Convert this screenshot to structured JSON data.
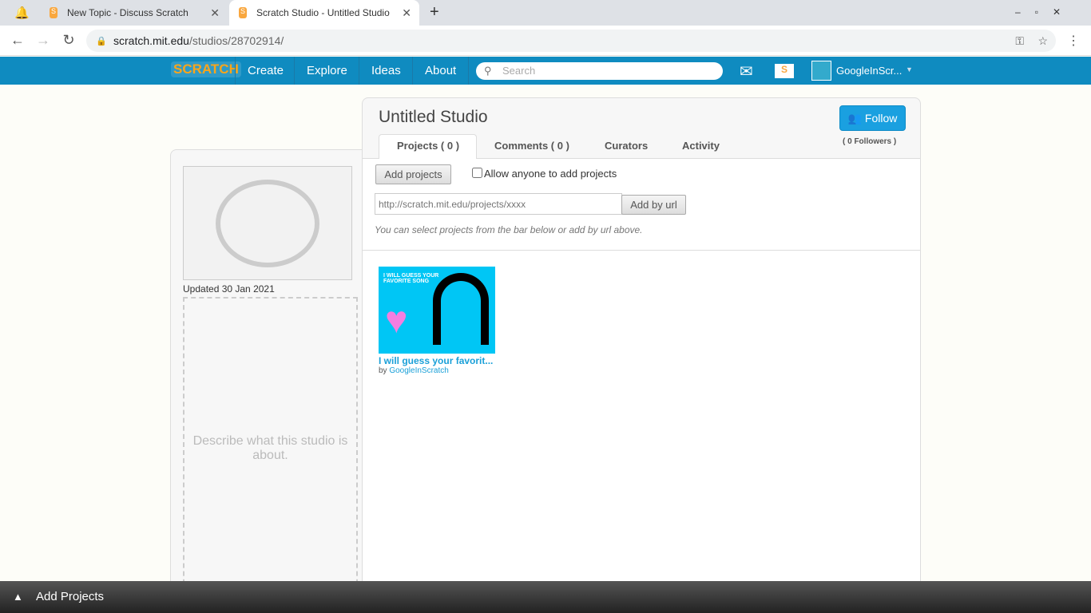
{
  "browser": {
    "tabs": [
      {
        "title": "New Topic - Discuss Scratch"
      },
      {
        "title": "Scratch Studio - Untitled Studio"
      }
    ],
    "url_host": "scratch.mit.edu",
    "url_path": "/studios/28702914/"
  },
  "nav": {
    "logo": "SCRATCH",
    "items": [
      "Create",
      "Explore",
      "Ideas",
      "About"
    ],
    "search_placeholder": "Search",
    "username": "GoogleInScr..."
  },
  "studio": {
    "title": "Untitled Studio",
    "follow": "Follow",
    "followers": "( 0 Followers )",
    "updated": "Updated 30 Jan 2021",
    "description_placeholder": "Describe what this studio is about.",
    "tabs": [
      "Projects ( 0 )",
      "Comments ( 0 )",
      "Curators",
      "Activity"
    ],
    "add_projects": "Add projects",
    "allow_label": "Allow anyone to add projects",
    "url_placeholder": "http://scratch.mit.edu/projects/xxxx",
    "add_by_url": "Add by url",
    "hint": "You can select projects from the bar below or add by url above.",
    "projects": [
      {
        "title": "I will guess your favorit...",
        "by": "by",
        "author": "GoogleInScratch",
        "thumb_text": "I WILL GUESS YOUR FAVORITE SONG"
      }
    ]
  },
  "bottom_bar": {
    "label": "Add Projects"
  }
}
